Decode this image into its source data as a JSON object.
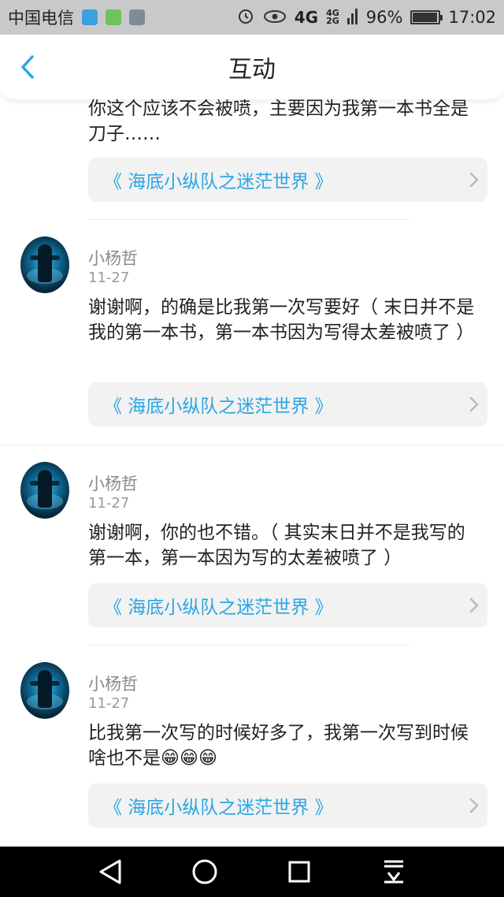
{
  "status_bar": {
    "carrier": "中国电信",
    "net_4g": "4G",
    "net_dual_top": "4G",
    "net_dual_bottom": "2G",
    "battery_percent_text": "96%",
    "battery_level": 0.96,
    "time": "17:02",
    "app_icon_colors": [
      "#3aa0e0",
      "#6ec35a",
      "#7c8b98"
    ]
  },
  "header": {
    "title": "互动",
    "back_icon": "chevron-left-icon",
    "accent_color": "#2aa6e4"
  },
  "comments": [
    {
      "text": "你这个应该不会被喷，主要因为我第一本书全是刀子……",
      "book": "《 海底小纵队之迷茫世界 》"
    },
    {
      "username": "小杨哲",
      "date": "11-27",
      "text": "谢谢啊，的确是比我第一次写要好（ 末日并不是我的第一本书，第一本书因为写得太差被喷了 ）",
      "book": "《 海底小纵队之迷茫世界 》"
    },
    {
      "username": "小杨哲",
      "date": "11-27",
      "text": "谢谢啊，你的也不错。（ 其实末日并不是我写的第一本，第一本因为写的太差被喷了 ）",
      "book": "《 海底小纵队之迷茫世界 》"
    },
    {
      "username": "小杨哲",
      "date": "11-27",
      "text": "比我第一次写的时候好多了，我第一次写到时候啥也不是😁😁😁",
      "book": "《 海底小纵队之迷茫世界 》"
    }
  ],
  "nav_bar": {
    "back_icon": "triangle-back-icon",
    "home_icon": "circle-home-icon",
    "recents_icon": "square-recents-icon",
    "menu_icon": "pull-down-icon"
  }
}
